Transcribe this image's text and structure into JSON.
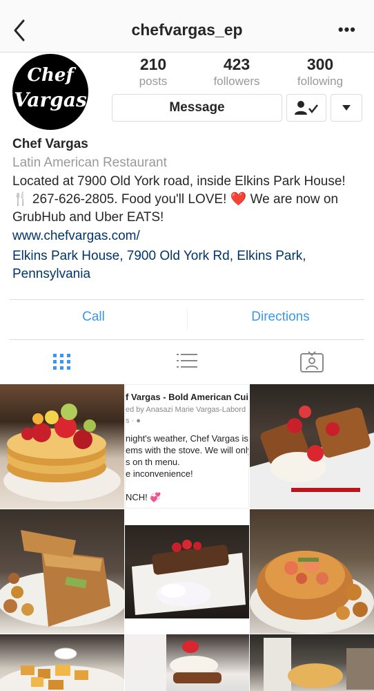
{
  "header": {
    "username": "chefvargas_ep",
    "back_icon": "chevron-left-icon",
    "more_icon": "more-horizontal-icon",
    "more_glyph": "•••"
  },
  "profile": {
    "avatar_line1": "Chef",
    "avatar_line2": "Vargas",
    "stats": [
      {
        "value": "210",
        "label": "posts"
      },
      {
        "value": "423",
        "label": "followers"
      },
      {
        "value": "300",
        "label": "following"
      }
    ],
    "message_label": "Message"
  },
  "bio": {
    "name": "Chef Vargas",
    "category": "Latin American Restaurant",
    "description": "Located at 7900 Old York road, inside Elkins Park House! 🍴 267-626-2805. Food you'll LOVE! ❤️ We are now on GrubHub and Uber EATS!",
    "website": "www.chefvargas.com/",
    "address": "Elkins Park House, 7900 Old York Rd, Elkins Park, Pennsylvania"
  },
  "actions": {
    "call": "Call",
    "directions": "Directions"
  },
  "tabs": [
    {
      "name": "grid-icon",
      "active": true
    },
    {
      "name": "list-icon",
      "active": false
    },
    {
      "name": "tagged-icon",
      "active": false
    }
  ],
  "text_post": {
    "title": "f Vargas - Bold American Cuis",
    "byline": "ed by Anasazi Marie Vargas-Labord",
    "byline2": "s · ",
    "lines": [
      "night's weather, Chef Vargas is",
      "ems with the stove. We will only",
      "s on th menu.",
      "e inconvenience!",
      "",
      "NCH! 💞"
    ]
  },
  "colors": {
    "link": "#003569",
    "action": "#3897f0",
    "active_tab": "#3897f0",
    "muted": "#999999"
  }
}
